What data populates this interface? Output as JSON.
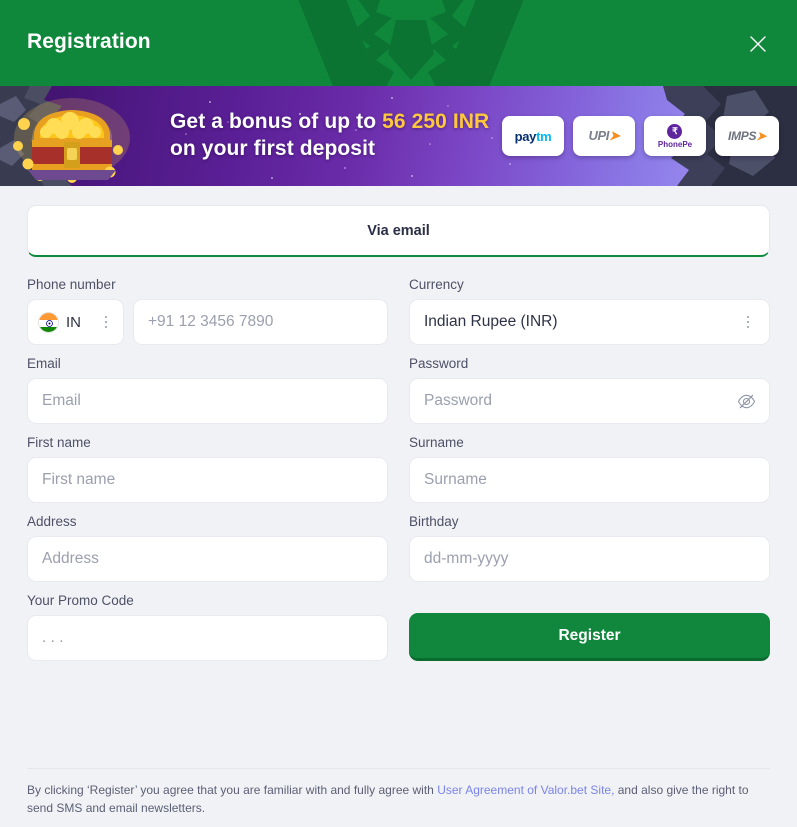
{
  "header": {
    "title": "Registration",
    "close_icon": "close-icon",
    "bg_color": "#10883b"
  },
  "banner": {
    "line1_prefix": "Get a bonus of up to ",
    "amount": "56 250 INR",
    "line2": "on your first deposit",
    "amount_color": "#ffc83c",
    "payment_methods": [
      {
        "name": "Paytm",
        "part1": "pay",
        "part2": "tm"
      },
      {
        "name": "UPI",
        "text": "UPI",
        "arrow": "➤"
      },
      {
        "name": "PhonePe",
        "mark": "₹",
        "text": "PhonePe"
      },
      {
        "name": "IMPS",
        "text": "IMPS",
        "arrow": "➤"
      }
    ]
  },
  "tabs": [
    {
      "label": "Via email",
      "active": true
    }
  ],
  "form": {
    "phone": {
      "label": "Phone number",
      "country_code": "IN",
      "country_flag": "india-flag-icon",
      "placeholder": "+91 12 3456 7890",
      "value": ""
    },
    "currency": {
      "label": "Currency",
      "selected": "Indian Rupee (INR)"
    },
    "email": {
      "label": "Email",
      "placeholder": "Email",
      "value": ""
    },
    "password": {
      "label": "Password",
      "placeholder": "Password",
      "value": "",
      "toggle_icon": "eye-off-icon"
    },
    "first_name": {
      "label": "First name",
      "placeholder": "First name",
      "value": ""
    },
    "surname": {
      "label": "Surname",
      "placeholder": "Surname",
      "value": ""
    },
    "address": {
      "label": "Address",
      "placeholder": "Address",
      "value": ""
    },
    "birthday": {
      "label": "Birthday",
      "placeholder": "dd-mm-yyyy",
      "value": ""
    },
    "promo_code": {
      "label": "Your Promo Code",
      "placeholder": ". . .",
      "value": ""
    },
    "submit": {
      "label": "Register",
      "color": "#10873c"
    }
  },
  "footer": {
    "text_before": "By clicking ‘Register’ you agree that you are familiar with and fully agree with ",
    "link_text": "User Agreement of Valor.bet Site,",
    "text_after": " and also give the right to send SMS and email newsletters.",
    "link_color": "#7b84e8"
  }
}
